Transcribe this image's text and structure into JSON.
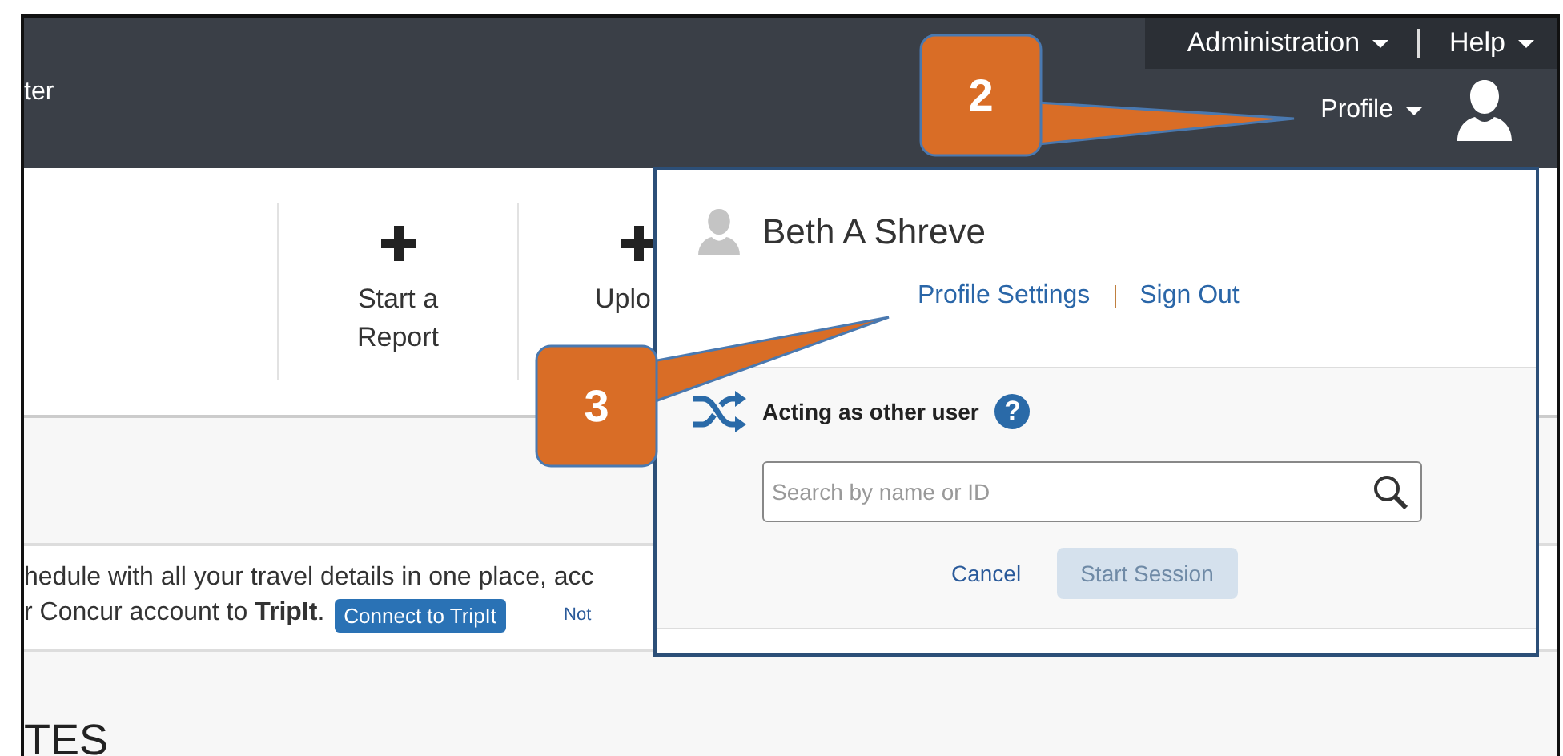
{
  "header": {
    "app_title": "ter",
    "menu": [
      {
        "label": "Administration"
      },
      {
        "label": "Help"
      }
    ],
    "profile": {
      "label": "Profile"
    }
  },
  "actions": [
    {
      "label": "Start a Report"
    },
    {
      "label": "Uplo"
    }
  ],
  "banner": {
    "line_1": "hedule with all your travel details in one place, acc",
    "line_2": "r Concur account to **TripIt**.",
    "button": "Connect to TripIt",
    "link": "Not"
  },
  "section_heading": "TES",
  "profile_menu": {
    "name": "Beth A Shreve",
    "links": [
      "Profile Settings",
      "Sign Out"
    ],
    "delegate": {
      "title": "Acting as other user",
      "help": "?",
      "search": {
        "placeholder": "Search by name or ID"
      },
      "cancel": "Cancel",
      "start": {
        "label": "Start Session",
        "disabled": true
      }
    }
  },
  "callouts": [
    {
      "number": "2"
    },
    {
      "number": "3"
    }
  ]
}
